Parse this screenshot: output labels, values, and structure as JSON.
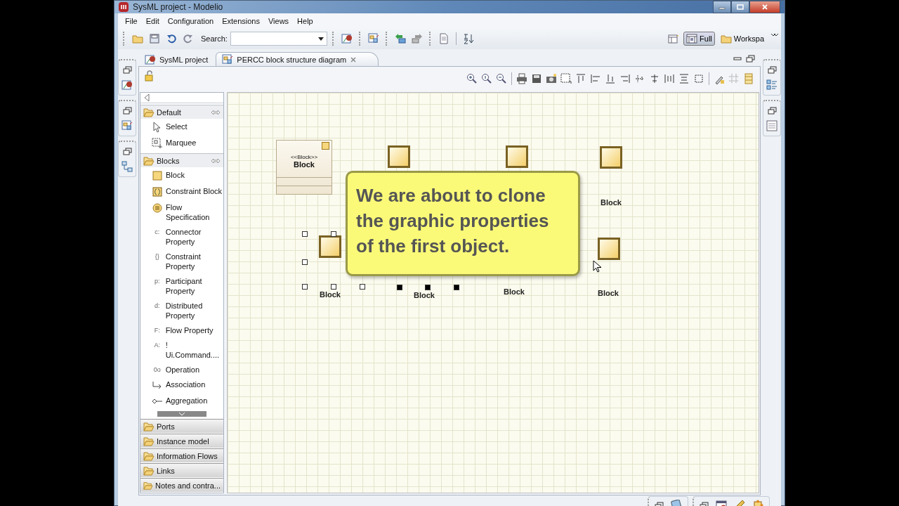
{
  "window": {
    "title": "SysML project - Modelio"
  },
  "menu": [
    "File",
    "Edit",
    "Configuration",
    "Extensions",
    "Views",
    "Help"
  ],
  "toolbar": {
    "search_label": "Search:"
  },
  "perspectives": [
    {
      "label": "Full",
      "selected": true
    },
    {
      "label": "Workspa",
      "selected": false
    }
  ],
  "tabs": [
    {
      "label": "SysML project",
      "selected": false,
      "closable": false
    },
    {
      "label": "PERCC block structure diagram",
      "selected": true,
      "closable": true
    }
  ],
  "palette": {
    "groups": [
      {
        "label": "Default",
        "expanded": true,
        "items": [
          {
            "kind": "pointer",
            "label": "Select"
          },
          {
            "kind": "marquee",
            "label": "Marquee"
          }
        ]
      },
      {
        "label": "Blocks",
        "expanded": true,
        "items": [
          {
            "kind": "block",
            "label": "Block"
          },
          {
            "kind": "constraint",
            "label": "Constraint Block"
          },
          {
            "kind": "flow",
            "label": "Flow Specification"
          },
          {
            "kind": "glyph",
            "glyph": "c:",
            "label": "Connector Property"
          },
          {
            "kind": "glyph",
            "glyph": "{}",
            "label": "Constraint Property"
          },
          {
            "kind": "glyph",
            "glyph": "p:",
            "label": "Participant Property"
          },
          {
            "kind": "glyph",
            "glyph": "d:",
            "label": "Distributed Property"
          },
          {
            "kind": "glyph",
            "glyph": "F:",
            "label": "Flow Property"
          },
          {
            "kind": "glyph",
            "glyph": "A:",
            "label": "! Ui.Command...."
          },
          {
            "kind": "glyph",
            "glyph": "0o",
            "label": "Operation"
          },
          {
            "kind": "association",
            "label": "Association"
          },
          {
            "kind": "aggregation",
            "label": "Aggregation"
          }
        ]
      },
      {
        "label": "Ports",
        "expanded": false
      },
      {
        "label": "Instance model",
        "expanded": false
      },
      {
        "label": "Information Flows",
        "expanded": false
      },
      {
        "label": "Links",
        "expanded": false
      },
      {
        "label": "Notes and contra...",
        "expanded": false
      }
    ]
  },
  "diagram": {
    "nodes": [
      {
        "kind": "classifier",
        "stereotype": "<<Block>>",
        "name": "Block",
        "selected": false
      },
      {
        "kind": "block",
        "selected": false
      },
      {
        "kind": "block",
        "selected": false
      },
      {
        "kind": "block",
        "label": "Block",
        "selected": false
      },
      {
        "kind": "block",
        "label": "Block",
        "selected": true,
        "primary": false
      },
      {
        "kind": "label",
        "label": "Block",
        "selected": true,
        "primary": true
      },
      {
        "kind": "label",
        "label": "Block",
        "selected": false
      },
      {
        "kind": "block",
        "label": "Block",
        "selected": false
      }
    ],
    "callout": {
      "text": "We are about to clone the graphic properties of the first object."
    }
  }
}
